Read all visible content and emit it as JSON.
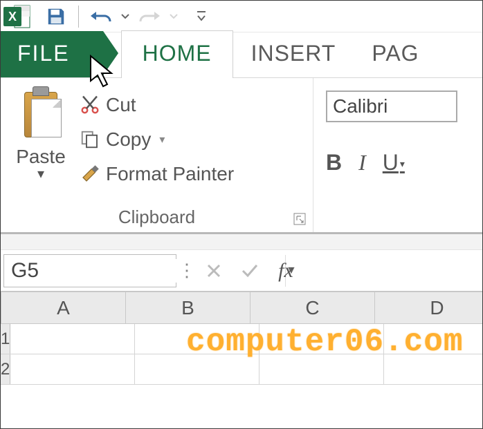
{
  "qat": {
    "app": "Excel"
  },
  "tabs": {
    "file": "FILE",
    "home": "HOME",
    "insert": "INSERT",
    "page": "PAG"
  },
  "clipboard": {
    "paste": "Paste",
    "cut": "Cut",
    "copy": "Copy",
    "format_painter": "Format Painter",
    "group_label": "Clipboard"
  },
  "font": {
    "family": "Calibri",
    "bold": "B",
    "italic": "I",
    "underline": "U"
  },
  "namebox": "G5",
  "fx_label": "fx",
  "columns": [
    "A",
    "B",
    "C",
    "D"
  ],
  "rows": [
    "1",
    "2"
  ],
  "colors": {
    "excel_green": "#1e7145",
    "watermark": "#ffb030"
  },
  "watermark": "computer06.com"
}
